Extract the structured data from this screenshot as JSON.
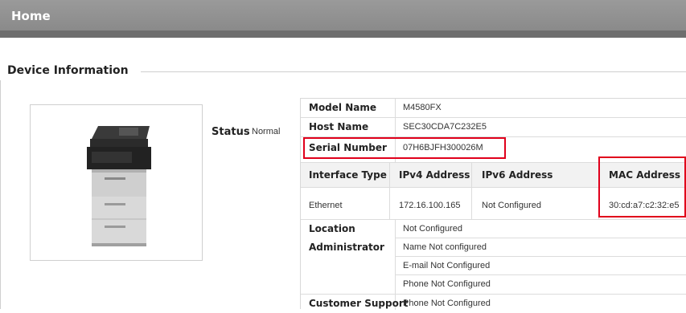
{
  "header": {
    "title": "Home"
  },
  "section": {
    "title": "Device Information"
  },
  "device": {
    "status_label": "Status",
    "status_value": "Normal",
    "image_icon": "printer-icon"
  },
  "info": {
    "model_name": {
      "label": "Model Name",
      "value": "M4580FX"
    },
    "host_name": {
      "label": "Host Name",
      "value": "SEC30CDA7C232E5"
    },
    "serial_number": {
      "label": "Serial Number",
      "value": "07H6BJFH300026M"
    },
    "interfaces": {
      "headers": [
        "Interface Type",
        "IPv4 Address",
        "IPv6 Address",
        "MAC Address"
      ],
      "rows": [
        {
          "type": "Ethernet",
          "ipv4": "172.16.100.165",
          "ipv6": "Not Configured",
          "mac": "30:cd:a7:c2:32:e5"
        }
      ]
    },
    "location": {
      "label": "Location",
      "value": "Not Configured"
    },
    "administrator": {
      "label": "Administrator",
      "name": "Name Not configured",
      "email": "E-mail Not Configured",
      "phone": "Phone Not Configured"
    },
    "customer_support": {
      "label": "Customer Support",
      "phone": "Phone Not Configured"
    }
  },
  "highlight_color": "#e0001b"
}
